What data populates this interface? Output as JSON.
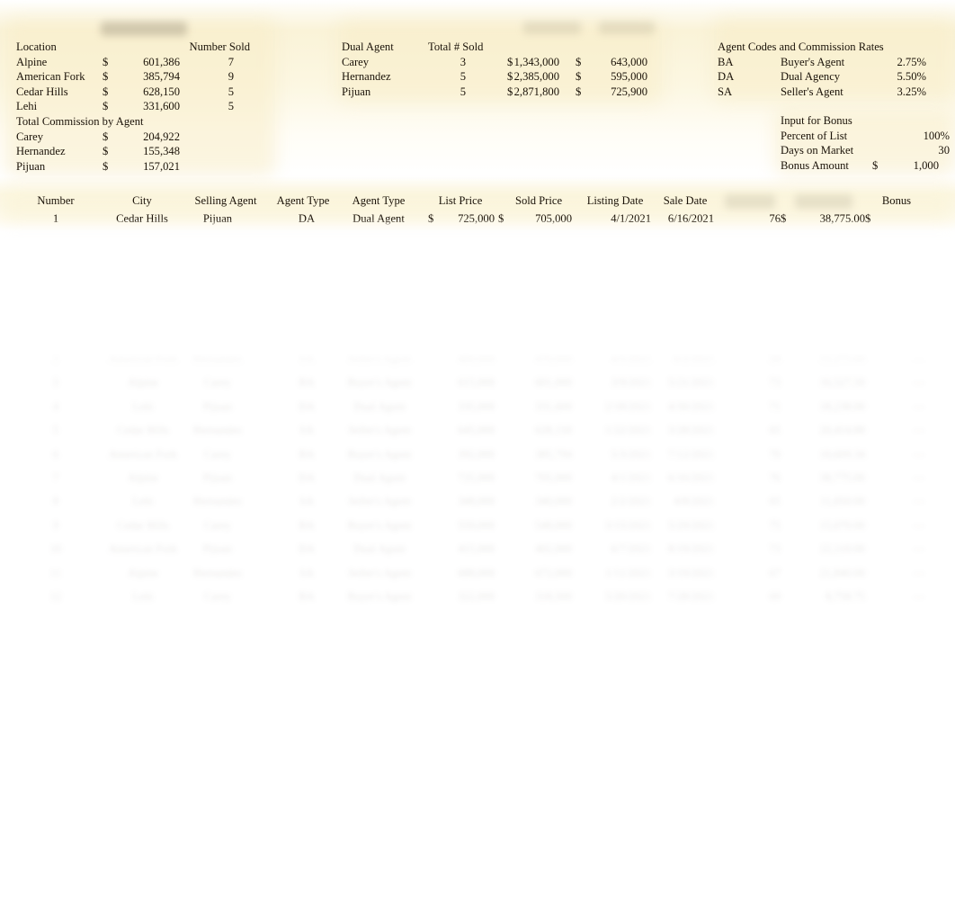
{
  "document": {
    "kind": "spreadsheet",
    "background_color": "#ffffff",
    "panel_tint": "#faf3d8",
    "text_color": "#1a1208"
  },
  "summary_sales_by_location": {
    "obscured_title": "",
    "headers": [
      "Location",
      "",
      "",
      "Number Sold"
    ],
    "rows": [
      {
        "location": "Alpine",
        "currency": "$",
        "amount": "601,386",
        "number_sold": "7"
      },
      {
        "location": "American Fork",
        "currency": "$",
        "amount": "385,794",
        "number_sold": "9"
      },
      {
        "location": "Cedar Hills",
        "currency": "$",
        "amount": "628,150",
        "number_sold": "5"
      },
      {
        "location": "Lehi",
        "currency": "$",
        "amount": "331,600",
        "number_sold": "5"
      }
    ]
  },
  "summary_commission_by_agent": {
    "title": "Total Commission by Agent",
    "rows": [
      {
        "agent": "Carey",
        "currency": "$",
        "amount": "204,922"
      },
      {
        "agent": "Hernandez",
        "currency": "$",
        "amount": "155,348"
      },
      {
        "agent": "Pijuan",
        "currency": "$",
        "amount": "157,021"
      }
    ]
  },
  "summary_dual_agent": {
    "headers": [
      "Dual Agent",
      "Total # Sold",
      "",
      ""
    ],
    "rows": [
      {
        "agent": "Carey",
        "total_sold": "3",
        "currency1": "$",
        "amount1": "1,343,000",
        "currency2": "$",
        "amount2": "643,000"
      },
      {
        "agent": "Hernandez",
        "total_sold": "5",
        "currency1": "$",
        "amount1": "2,385,000",
        "currency2": "$",
        "amount2": "595,000"
      },
      {
        "agent": "Pijuan",
        "total_sold": "5",
        "currency1": "$",
        "amount1": "2,871,800",
        "currency2": "$",
        "amount2": "725,900"
      }
    ]
  },
  "agent_codes": {
    "title": "Agent Codes and Commission Rates",
    "rows": [
      {
        "code": "BA",
        "description": "Buyer's Agent",
        "rate": "2.75%"
      },
      {
        "code": "DA",
        "description": "Dual Agency",
        "rate": "5.50%"
      },
      {
        "code": "SA",
        "description": "Seller's Agent",
        "rate": "3.25%"
      }
    ]
  },
  "input_for_bonus": {
    "title": "Input for Bonus",
    "rows": [
      {
        "label": "Percent of List",
        "currency": "",
        "value": "100%"
      },
      {
        "label": "Days on Market",
        "currency": "",
        "value": "30"
      },
      {
        "label": "Bonus Amount",
        "currency": "$",
        "value": "1,000"
      }
    ]
  },
  "main_table": {
    "headers": [
      "Number",
      "City",
      "Selling Agent",
      "Agent Type",
      "Agent Type",
      "List Price",
      "Sold Price",
      "Listing Date",
      "Sale Date",
      "",
      "",
      "Bonus"
    ],
    "rows": [
      {
        "number": "1",
        "city": "Cedar Hills",
        "selling_agent": "Pijuan",
        "agent_code": "DA",
        "agent_type": "Dual Agent",
        "list_currency": "$",
        "list_price": "725,000",
        "sold_currency": "$",
        "sold_price": "705,000",
        "listing_date": "4/1/2021",
        "sale_date": "6/16/2021",
        "days": "76",
        "commission_currency": "$",
        "commission": "38,775.00",
        "bonus_currency": "$"
      }
    ]
  }
}
